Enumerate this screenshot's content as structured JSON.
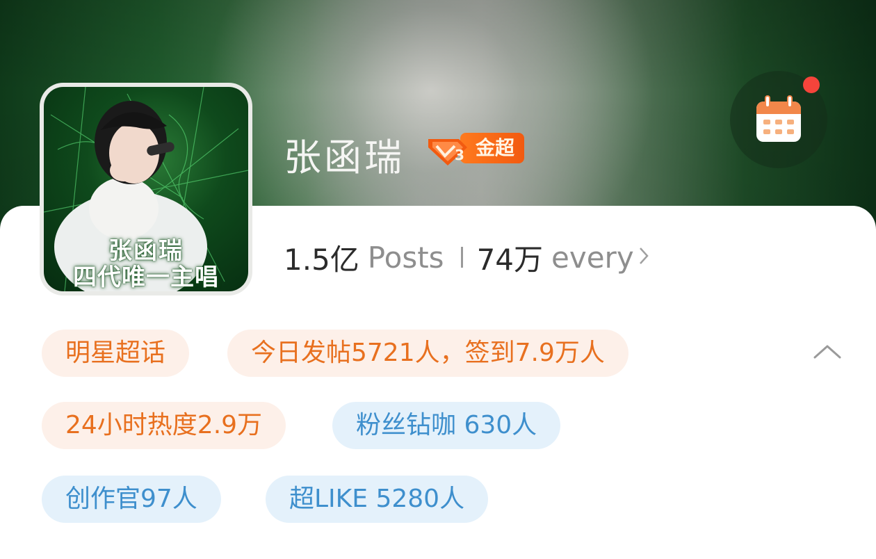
{
  "profile": {
    "name": "张函瑞",
    "badge_label": "金超",
    "badge_level": "3",
    "avatar_caption_line1": "张函瑞",
    "avatar_caption_line2": "四代唯一主唱"
  },
  "stats": {
    "posts_count": "1.5亿",
    "posts_label": "Posts",
    "followers_count": "74万",
    "followers_label": "every"
  },
  "tags": {
    "row1": [
      "明星超话",
      "今日发帖5721人，签到7.9万人"
    ],
    "row2": [
      "24小时热度2.9万",
      "粉丝钻咖 630人"
    ],
    "row3": [
      "创作官97人",
      "超LIKE 5280人"
    ]
  },
  "colors": {
    "tag_orange_text": "#e8701f",
    "tag_orange_bg": "#fdf0e9",
    "tag_blue_text": "#3e8fcd",
    "tag_blue_bg": "#e4f1fb",
    "notification_dot": "#f5443b",
    "badge_orange": "#f25a10"
  },
  "icons": {
    "calendar": "calendar-icon",
    "collapse": "chevron-up-icon",
    "stats_more": "chevron-right-icon",
    "badge": "diamond-icon"
  }
}
